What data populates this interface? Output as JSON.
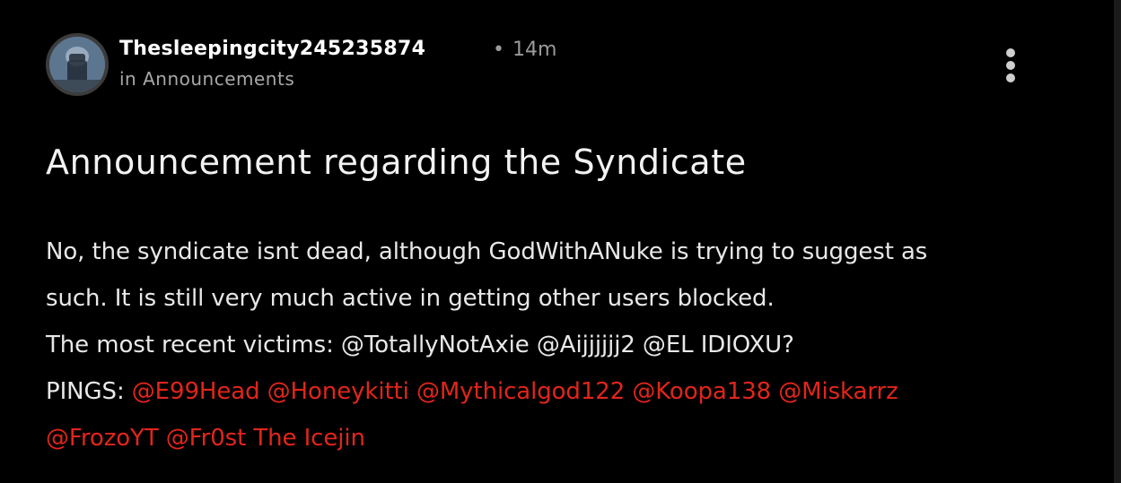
{
  "post": {
    "author": "Thesleepingcity245235874",
    "separator": "•",
    "time_ago": "14m",
    "community": "in Announcements",
    "title": "Announcement regarding the Syndicate",
    "body_line1": "No, the syndicate isnt dead, although GodWithANuke is trying to suggest as",
    "body_line2": "such. It is still very much active in getting other users blocked.",
    "body_line3": "The most recent victims: @TotallyNotAxie @Aijjjjjj2 @EL IDIOXU?",
    "pings_label": "PINGS:",
    "pings": [
      "@E99Head",
      "@Honeykitti",
      "@Mythicalgod122",
      "@Koopa138",
      "@Miskarrz",
      "@FrozoYT",
      "@Fr0st The Icejin"
    ]
  },
  "icons": {
    "more": "more-vertical-icon",
    "avatar": "user-avatar"
  },
  "colors": {
    "background": "#000000",
    "mention": "#e1251b",
    "meta": "#9a9a9a"
  }
}
